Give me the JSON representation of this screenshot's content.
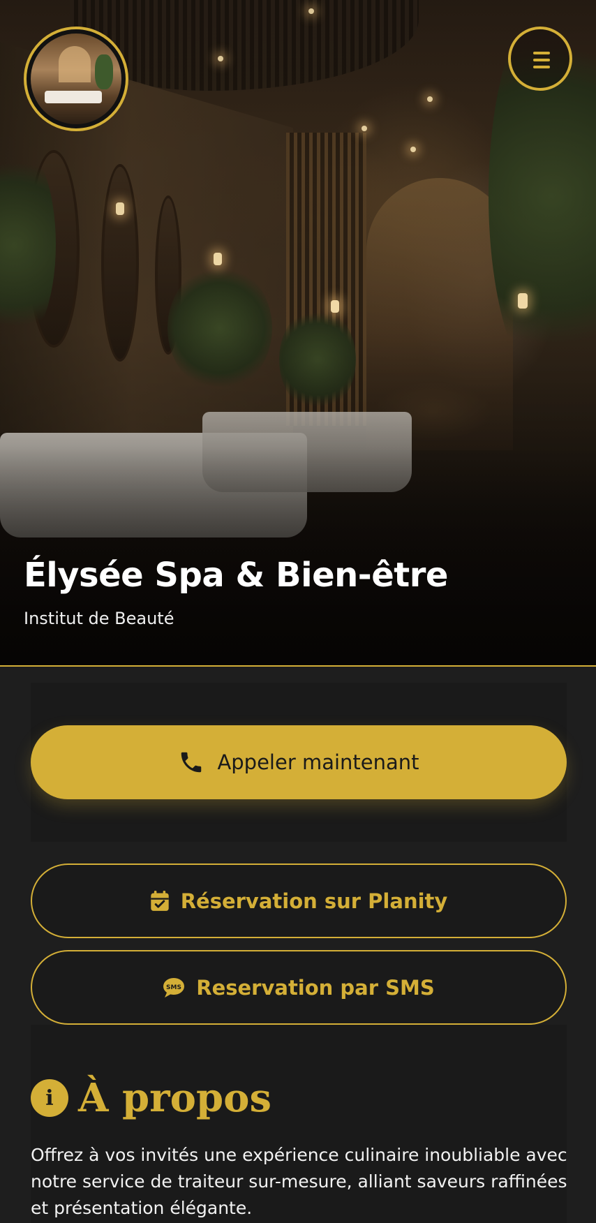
{
  "hero": {
    "title": "Élysée Spa & Bien-être",
    "subtitle": "Institut de Beauté"
  },
  "logo": {
    "icon": "spa-logo-image"
  },
  "menu": {
    "icon": "hamburger-menu-icon"
  },
  "actions": {
    "call_label": "Appeler maintenant",
    "call_icon": "phone-icon",
    "planity_label": "Réservation sur Planity",
    "planity_icon": "calendar-check-icon",
    "sms_label": "Reservation par SMS",
    "sms_icon": "sms-bubble-icon"
  },
  "about": {
    "title": "À propos",
    "icon": "info-icon",
    "text": "Offrez à vos invités une expérience culinaire inoubliable avec notre service de traiteur sur-mesure, alliant saveurs raffinées et présentation élégante."
  },
  "colors": {
    "accent": "#d4af37",
    "background": "#1e1e1e",
    "panel": "#1a1a1a",
    "text": "#ffffff"
  }
}
